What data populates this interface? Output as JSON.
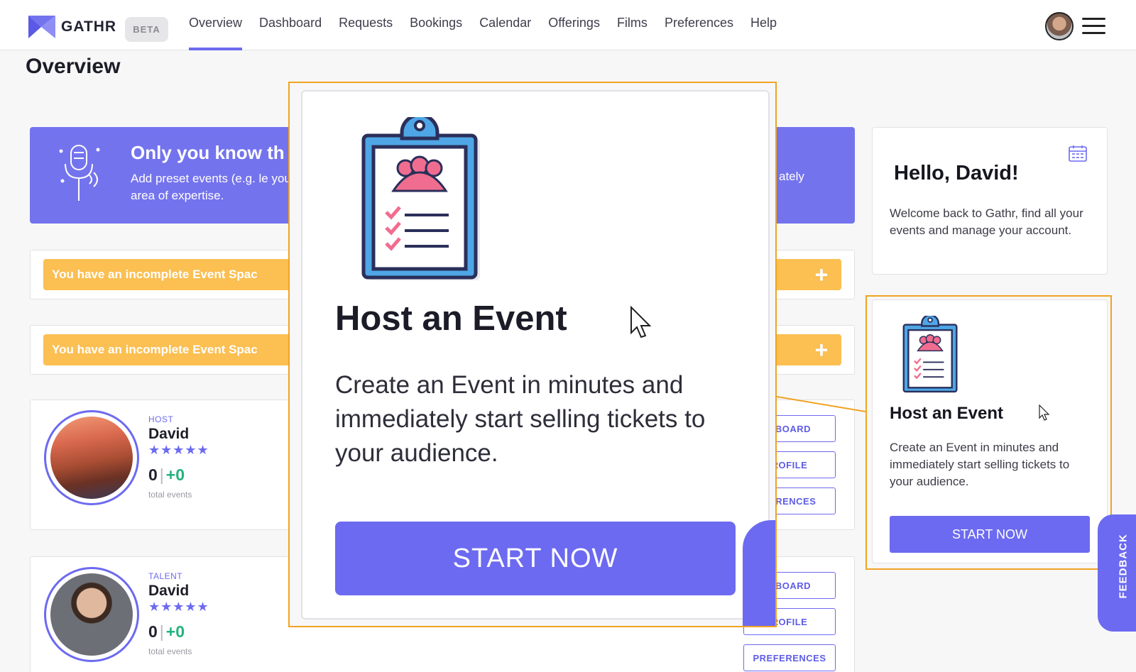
{
  "app": {
    "brand": "GATHR",
    "beta_label": "BETA",
    "accent": "#6c6af0",
    "warning": "#fbbf52"
  },
  "nav": {
    "items": [
      {
        "label": "Overview",
        "active": true
      },
      {
        "label": "Dashboard"
      },
      {
        "label": "Requests"
      },
      {
        "label": "Bookings"
      },
      {
        "label": "Calendar"
      },
      {
        "label": "Offerings"
      },
      {
        "label": "Films"
      },
      {
        "label": "Preferences"
      },
      {
        "label": "Help"
      }
    ]
  },
  "page": {
    "title": "Overview"
  },
  "banner": {
    "title": "Only you know th",
    "text": "Add preset events (e.g. le your area of expertise.",
    "right_text": "ately",
    "icon": "microphone-icon"
  },
  "incomplete": [
    {
      "text": "You have an incomplete Event Spac",
      "action": "+"
    },
    {
      "text": "You have an incomplete Event Spac",
      "action": "+"
    }
  ],
  "profiles": [
    {
      "role": "HOST",
      "name": "David",
      "stars": "★★★★★",
      "count": "0",
      "delta": "+0",
      "label": "total events",
      "buttons": [
        "HBOARD",
        "ROFILE",
        "FERENCES"
      ]
    },
    {
      "role": "TALENT",
      "name": "David",
      "stars": "★★★★★",
      "count": "0",
      "delta": "+0",
      "label": "total events",
      "buttons": [
        "HBOARD",
        "ROFILE",
        "PREFERENCES"
      ]
    }
  ],
  "hello": {
    "title": "Hello, David!",
    "text": "Welcome back to Gathr, find all your events and manage your account.",
    "icon": "calendar-icon"
  },
  "host_event": {
    "title": "Host an Event",
    "text": "Create an Event in minutes and immediately start selling tickets to your audience.",
    "button": "START NOW",
    "icon": "clipboard-icon"
  },
  "feedback": {
    "label": "FEEDBACK"
  }
}
